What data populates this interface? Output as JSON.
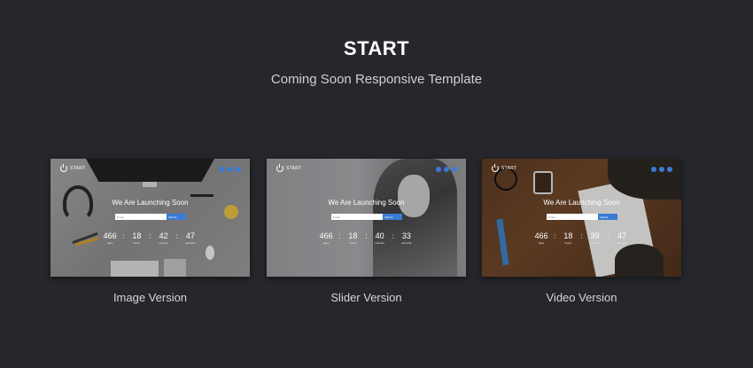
{
  "header": {
    "brand": "START",
    "tagline": "Coming Soon Responsive Template"
  },
  "accent_color": "#3a7bd5",
  "cards": [
    {
      "caption": "Image Version",
      "preview": {
        "brand": "START",
        "heading": "We Are Launching Soon",
        "email_placeholder": "Email",
        "submit_label": "Submit",
        "countdown": [
          {
            "value": "466",
            "label": "days"
          },
          {
            "value": "18",
            "label": "hours"
          },
          {
            "value": "42",
            "label": "minutes"
          },
          {
            "value": "47",
            "label": "seconds"
          }
        ]
      }
    },
    {
      "caption": "Slider Version",
      "preview": {
        "brand": "START",
        "heading": "We Are Launching Soon",
        "email_placeholder": "Email",
        "submit_label": "Submit",
        "countdown": [
          {
            "value": "466",
            "label": "days"
          },
          {
            "value": "18",
            "label": "hours"
          },
          {
            "value": "40",
            "label": "minutes"
          },
          {
            "value": "33",
            "label": "seconds"
          }
        ]
      }
    },
    {
      "caption": "Video Version",
      "preview": {
        "brand": "START",
        "heading": "We Are Launching Soon",
        "email_placeholder": "Email",
        "submit_label": "Submit",
        "countdown": [
          {
            "value": "466",
            "label": "days"
          },
          {
            "value": "18",
            "label": "hours"
          },
          {
            "value": "39",
            "label": "minutes"
          },
          {
            "value": "47",
            "label": "seconds"
          }
        ]
      }
    }
  ]
}
